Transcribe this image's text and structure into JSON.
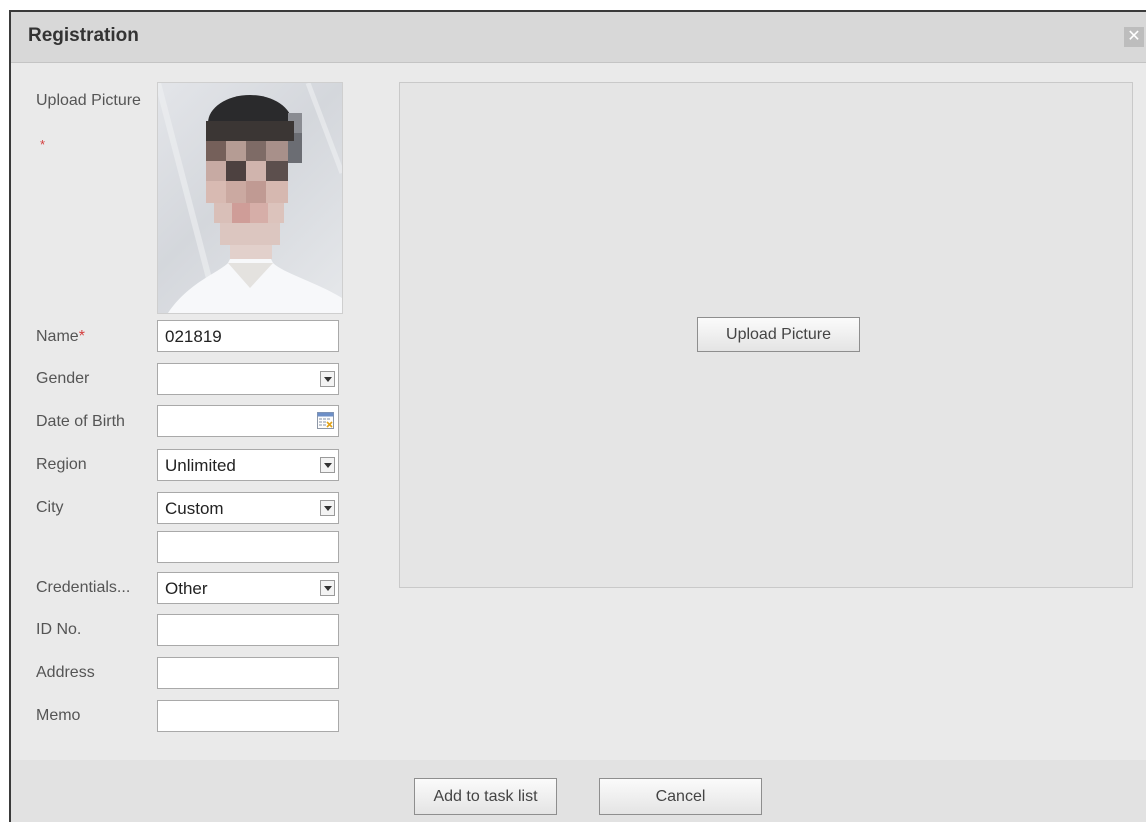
{
  "dialog": {
    "title": "Registration",
    "close_icon": "close-icon"
  },
  "form": {
    "upload_picture_label": "Upload Picture",
    "required_mark": "*",
    "name_label": "Name",
    "name_value": "021819",
    "gender_label": "Gender",
    "gender_value": "",
    "dob_label": "Date of Birth",
    "dob_value": "",
    "region_label": "Region",
    "region_value": "Unlimited",
    "city_label": "City",
    "city_value": "Custom",
    "city_custom_value": "",
    "credentials_label": "Credentials...",
    "credentials_value": "Other",
    "id_label": "ID No.",
    "id_value": "",
    "address_label": "Address",
    "address_value": "",
    "memo_label": "Memo",
    "memo_value": ""
  },
  "preview": {
    "upload_button": "Upload Picture"
  },
  "footer": {
    "add_button": "Add to task list",
    "cancel_button": "Cancel"
  },
  "icons": {
    "dropdown": "chevron-down-icon",
    "calendar": "calendar-icon"
  }
}
